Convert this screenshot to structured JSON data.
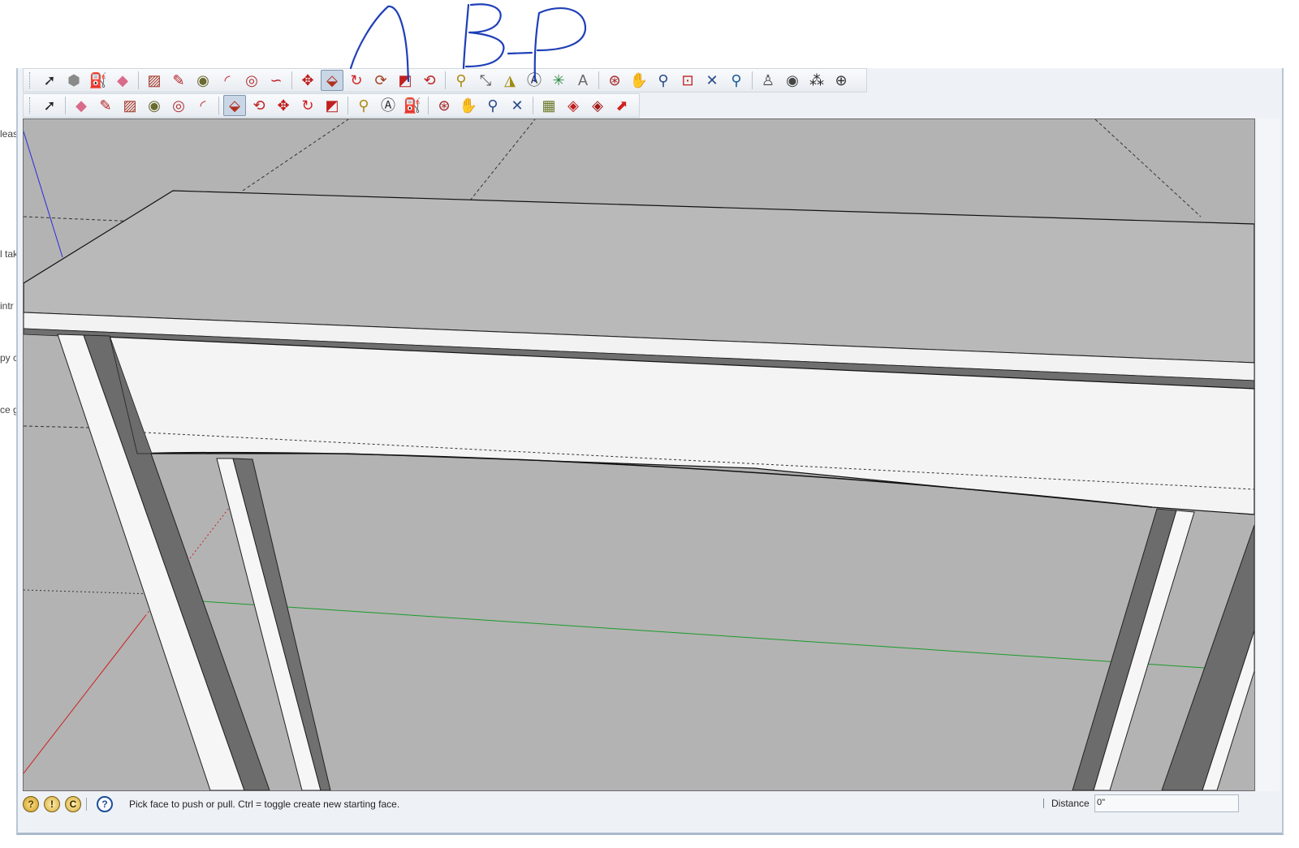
{
  "sidebar_text": [
    "leas",
    "l tak",
    "intr",
    "py c",
    "ce g"
  ],
  "toolbars": {
    "large_tool_set": [
      {
        "name": "select-tool",
        "glyph": "➚",
        "color": "#222222"
      },
      {
        "name": "make-component-tool",
        "glyph": "⬢",
        "color": "#8a8a8a"
      },
      {
        "name": "paint-bucket-tool",
        "glyph": "⛽",
        "color": "#7a9a1f"
      },
      {
        "name": "eraser-tool",
        "glyph": "◆",
        "color": "#d96a8a"
      },
      {
        "sep": true
      },
      {
        "name": "rectangle-tool",
        "glyph": "▨",
        "color": "#a33a2a"
      },
      {
        "name": "line-tool",
        "glyph": "✎",
        "color": "#b02020"
      },
      {
        "name": "circle-tool",
        "glyph": "◉",
        "color": "#6a6a30"
      },
      {
        "name": "arc-tool",
        "glyph": "◜",
        "color": "#c0303a"
      },
      {
        "name": "polygon-tool",
        "glyph": "◎",
        "color": "#b03030"
      },
      {
        "name": "freehand-tool",
        "glyph": "∽",
        "color": "#c02020"
      },
      {
        "sep": true
      },
      {
        "name": "move-tool",
        "glyph": "✥",
        "color": "#c01818"
      },
      {
        "name": "push-pull-tool",
        "glyph": "⬙",
        "color": "#b03020",
        "active": true
      },
      {
        "name": "rotate-tool",
        "glyph": "↻",
        "color": "#d02020"
      },
      {
        "name": "follow-me-tool",
        "glyph": "⟳",
        "color": "#a04020"
      },
      {
        "name": "scale-tool",
        "glyph": "◩",
        "color": "#c02020"
      },
      {
        "name": "offset-tool",
        "glyph": "⟲",
        "color": "#c02020"
      },
      {
        "sep": true
      },
      {
        "name": "tape-measure-tool",
        "glyph": "⚲",
        "color": "#b08a10"
      },
      {
        "name": "dimension-tool",
        "glyph": "⤡",
        "color": "#555555"
      },
      {
        "name": "protractor-tool",
        "glyph": "◮",
        "color": "#a08a10"
      },
      {
        "name": "text-tool",
        "glyph": "Ⓐ",
        "color": "#333333"
      },
      {
        "name": "axes-tool",
        "glyph": "✳",
        "color": "#2a8a3a"
      },
      {
        "name": "3d-text-tool",
        "glyph": "A",
        "color": "#666666"
      },
      {
        "sep": true
      },
      {
        "name": "orbit-tool",
        "glyph": "⊛",
        "color": "#a02020"
      },
      {
        "name": "pan-tool",
        "glyph": "✋",
        "color": "#555555"
      },
      {
        "name": "zoom-tool",
        "glyph": "⚲",
        "color": "#2a4a8a"
      },
      {
        "name": "zoom-window-tool",
        "glyph": "⊡",
        "color": "#c02020"
      },
      {
        "name": "zoom-extents-tool",
        "glyph": "✕",
        "color": "#2a4a8a"
      },
      {
        "name": "previous-view-tool",
        "glyph": "⚲",
        "color": "#1a5a9a"
      },
      {
        "sep": true
      },
      {
        "name": "position-camera-tool",
        "glyph": "♙",
        "color": "#444444"
      },
      {
        "name": "look-around-tool",
        "glyph": "◉",
        "color": "#444444"
      },
      {
        "name": "walk-tool",
        "glyph": "⁂",
        "color": "#222222"
      },
      {
        "name": "section-plane-tool",
        "glyph": "⊕",
        "color": "#333333"
      }
    ],
    "getting_started": [
      {
        "name": "select-tool",
        "glyph": "➚",
        "color": "#222222"
      },
      {
        "sep": true
      },
      {
        "name": "eraser-tool",
        "glyph": "◆",
        "color": "#d96a8a"
      },
      {
        "name": "line-tool",
        "glyph": "✎",
        "color": "#b02020"
      },
      {
        "name": "rectangle-tool",
        "glyph": "▨",
        "color": "#a33a2a"
      },
      {
        "name": "circle-tool",
        "glyph": "◉",
        "color": "#6a6a30"
      },
      {
        "name": "polygon-tool",
        "glyph": "◎",
        "color": "#b03030"
      },
      {
        "name": "arc-tool",
        "glyph": "◜",
        "color": "#c0303a"
      },
      {
        "sep": true
      },
      {
        "name": "push-pull-tool",
        "glyph": "⬙",
        "color": "#b03020",
        "active": true
      },
      {
        "name": "offset-tool",
        "glyph": "⟲",
        "color": "#c02020"
      },
      {
        "name": "move-tool",
        "glyph": "✥",
        "color": "#c01818"
      },
      {
        "name": "rotate-tool",
        "glyph": "↻",
        "color": "#d02020"
      },
      {
        "name": "scale-tool",
        "glyph": "◩",
        "color": "#c02020"
      },
      {
        "sep": true
      },
      {
        "name": "tape-measure-tool",
        "glyph": "⚲",
        "color": "#b08a10"
      },
      {
        "name": "text-tool",
        "glyph": "Ⓐ",
        "color": "#333333"
      },
      {
        "name": "paint-bucket-tool",
        "glyph": "⛽",
        "color": "#7a9a1f"
      },
      {
        "sep": true
      },
      {
        "name": "orbit-tool",
        "glyph": "⊛",
        "color": "#a02020"
      },
      {
        "name": "pan-tool",
        "glyph": "✋",
        "color": "#555555"
      },
      {
        "name": "zoom-tool",
        "glyph": "⚲",
        "color": "#2a4a8a"
      },
      {
        "name": "zoom-extents-tool",
        "glyph": "✕",
        "color": "#2a4a8a"
      },
      {
        "sep": true
      },
      {
        "name": "warehouse-tool",
        "glyph": "▦",
        "color": "#6a7a2a"
      },
      {
        "name": "share-model-tool",
        "glyph": "◈",
        "color": "#c02020"
      },
      {
        "name": "extension-warehouse-tool",
        "glyph": "◈",
        "color": "#a01818"
      },
      {
        "name": "layout-send-tool",
        "glyph": "⬈",
        "color": "#d02020"
      }
    ]
  },
  "colors": {
    "sky": "#bdbdbd",
    "ground": "#b3b3b3",
    "annotation_ink": "#1f3fb8",
    "green_axis": "#1a9a2a",
    "red_axis": "#cc2020",
    "blue_axis": "#2a2adf"
  },
  "statusbar": {
    "icons": [
      {
        "name": "geolocation-icon",
        "glyph": "?"
      },
      {
        "name": "credits-icon",
        "glyph": "!"
      },
      {
        "name": "user-icon",
        "glyph": "C"
      }
    ],
    "help_glyph": "?",
    "hint": "Pick face to push or pull.  Ctrl = toggle create new starting face.",
    "measurements_label": "Distance",
    "measurements_value": "0\""
  }
}
